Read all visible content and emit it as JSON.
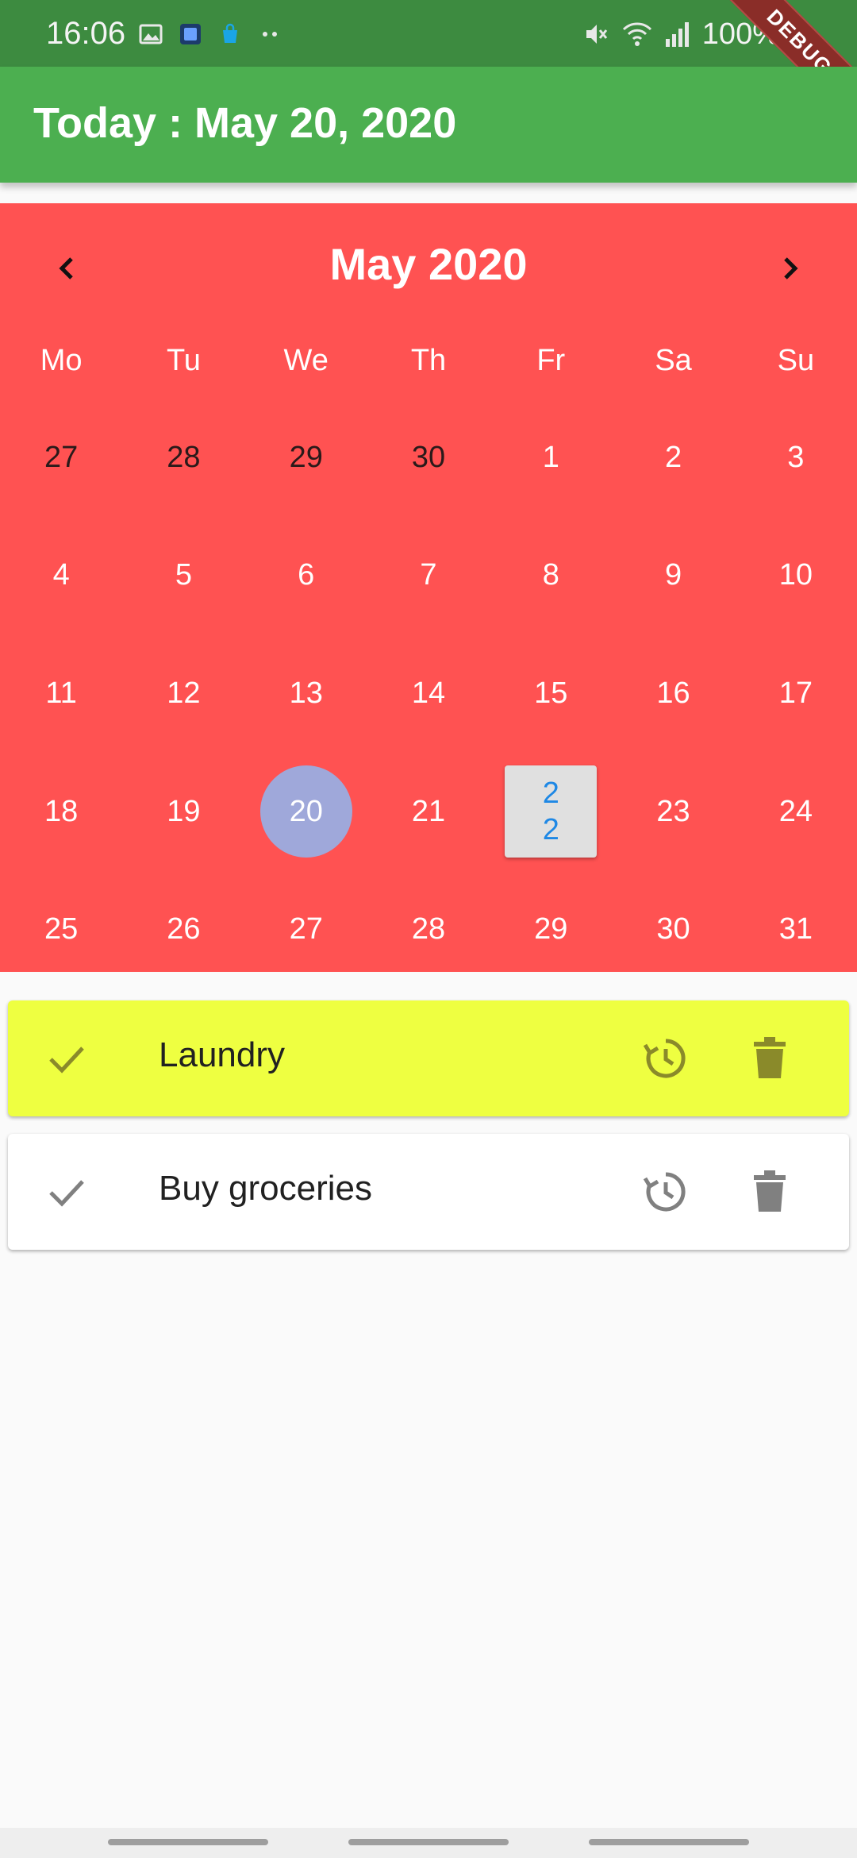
{
  "status_bar": {
    "time": "16:06",
    "battery": "100%",
    "icons": [
      "image-icon",
      "app-icon",
      "bag-icon",
      "dots-icon",
      "mute-icon",
      "wifi-icon",
      "signal-icon",
      "battery-icon"
    ],
    "debug_label": "DEBUG"
  },
  "app_bar": {
    "title": "Today : May 20, 2020",
    "color": "#4caf50"
  },
  "calendar": {
    "month_label": "May 2020",
    "background": "#ff5252",
    "weekdays": [
      "Mo",
      "Tu",
      "We",
      "Th",
      "Fr",
      "Sa",
      "Su"
    ],
    "weeks": [
      [
        "27",
        "28",
        "29",
        "30",
        "1",
        "2",
        "3"
      ],
      [
        "4",
        "5",
        "6",
        "7",
        "8",
        "9",
        "10"
      ],
      [
        "11",
        "12",
        "13",
        "14",
        "15",
        "16",
        "17"
      ],
      [
        "18",
        "19",
        "20",
        "21",
        "22",
        "23",
        "24"
      ],
      [
        "25",
        "26",
        "27",
        "28",
        "29",
        "30",
        "31"
      ]
    ],
    "today": "20",
    "selected": "22",
    "today_color": "#9fa8da",
    "selected_text_color": "#1e88e5"
  },
  "tasks": [
    {
      "title": "Laundry",
      "background": "#eeff41",
      "icon_color": "#8a8a2a"
    },
    {
      "title": "Buy groceries",
      "background": "#ffffff",
      "icon_color": "#808080"
    }
  ]
}
